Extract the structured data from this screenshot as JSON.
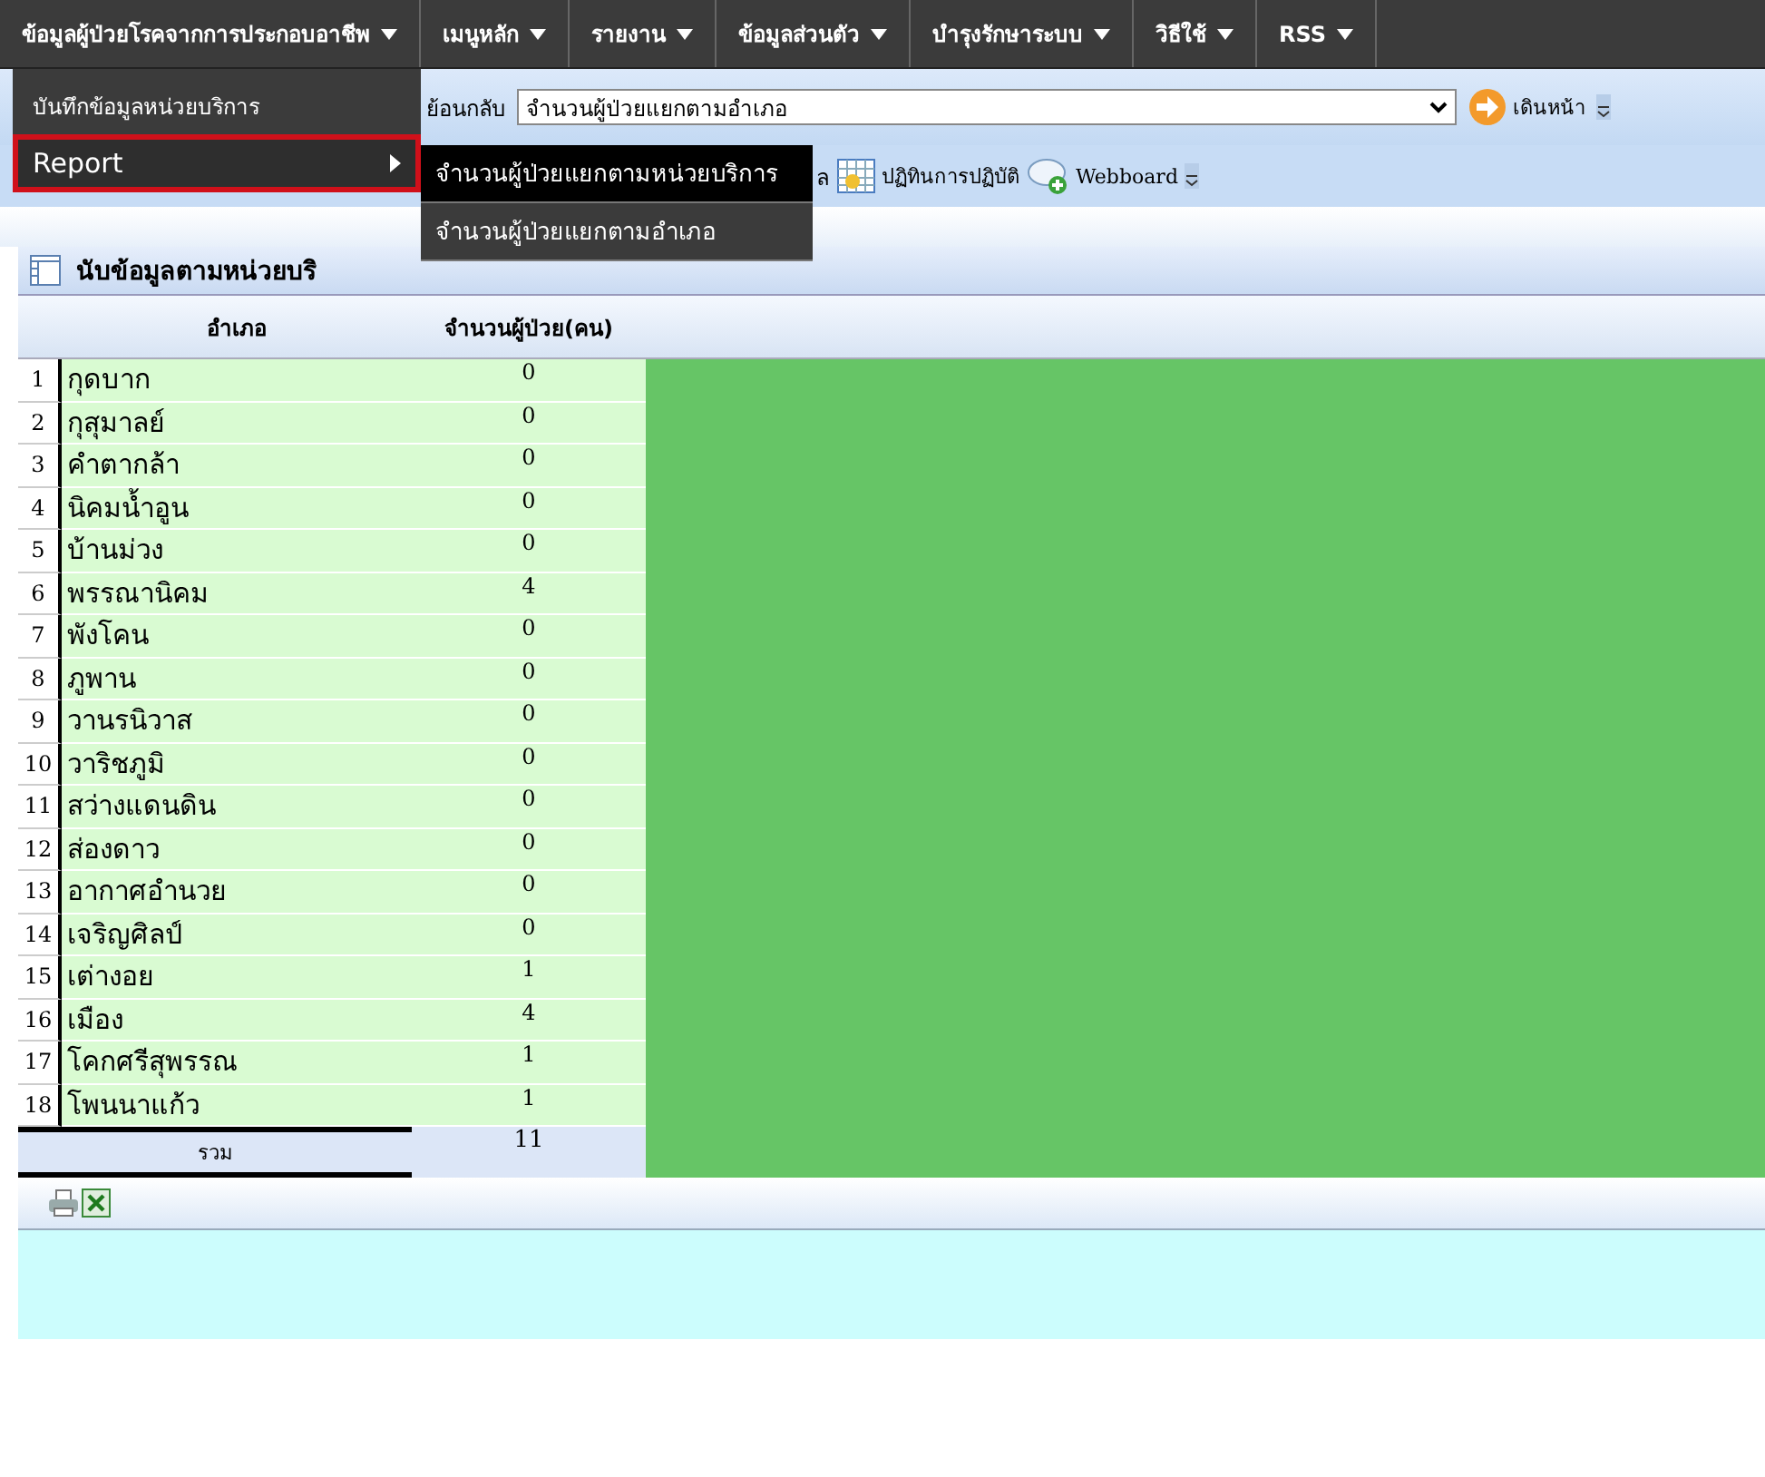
{
  "menubar": {
    "items": [
      {
        "label": "ข้อมูลผู้ป่วยโรคจากการประกอบอาชีพ"
      },
      {
        "label": "เมนูหลัก"
      },
      {
        "label": "รายงาน"
      },
      {
        "label": "ข้อมูลส่วนตัว"
      },
      {
        "label": "บำรุงรักษาระบบ"
      },
      {
        "label": "วิธีใช้"
      },
      {
        "label": "RSS"
      }
    ]
  },
  "dropdown": {
    "items": [
      {
        "label": "บันทึกข้อมูลหน่วยบริการ",
        "has_submenu": false,
        "selected": false
      },
      {
        "label": "Report",
        "has_submenu": true,
        "selected": true
      }
    ]
  },
  "submenu": {
    "items": [
      {
        "label": "จำนวนผู้ป่วยแยกตามหน่วยบริการ",
        "selected": true
      },
      {
        "label": "จำนวนผู้ป่วยแยกตามอำเภอ",
        "selected": false
      }
    ]
  },
  "toolbar": {
    "back_label": "ย้อนกลับ",
    "page_select": "จำนวนผู้ป่วยแยกตามอำเภอ",
    "forward_label": "เดินหน้า",
    "partial_label": "ล",
    "calendar_label": "ปฏิทินการปฏิบัติ",
    "webboard_label": "Webboard"
  },
  "panel": {
    "title": "นับข้อมูลตามหน่วยบริ"
  },
  "table": {
    "columns": [
      "อำเภอ",
      "จำนวนผู้ป่วย(คน)"
    ],
    "rows": [
      {
        "no": "1",
        "name": "กุดบาก",
        "count": "0"
      },
      {
        "no": "2",
        "name": "กุสุมาลย์",
        "count": "0"
      },
      {
        "no": "3",
        "name": "คำตากล้า",
        "count": "0"
      },
      {
        "no": "4",
        "name": "นิคมน้ำอูน",
        "count": "0"
      },
      {
        "no": "5",
        "name": "บ้านม่วง",
        "count": "0"
      },
      {
        "no": "6",
        "name": "พรรณานิคม",
        "count": "4"
      },
      {
        "no": "7",
        "name": "พังโคน",
        "count": "0"
      },
      {
        "no": "8",
        "name": "ภูพาน",
        "count": "0"
      },
      {
        "no": "9",
        "name": "วานรนิวาส",
        "count": "0"
      },
      {
        "no": "10",
        "name": "วาริชภูมิ",
        "count": "0"
      },
      {
        "no": "11",
        "name": "สว่างแดนดิน",
        "count": "0"
      },
      {
        "no": "12",
        "name": "ส่องดาว",
        "count": "0"
      },
      {
        "no": "13",
        "name": "อากาศอำนวย",
        "count": "0"
      },
      {
        "no": "14",
        "name": "เจริญศิลป์",
        "count": "0"
      },
      {
        "no": "15",
        "name": "เต่างอย",
        "count": "1"
      },
      {
        "no": "16",
        "name": "เมือง",
        "count": "4"
      },
      {
        "no": "17",
        "name": "โคกศรีสุพรรณ",
        "count": "1"
      },
      {
        "no": "18",
        "name": "โพนนาแก้ว",
        "count": "1"
      }
    ],
    "total_label": "รวม",
    "total": "11"
  }
}
